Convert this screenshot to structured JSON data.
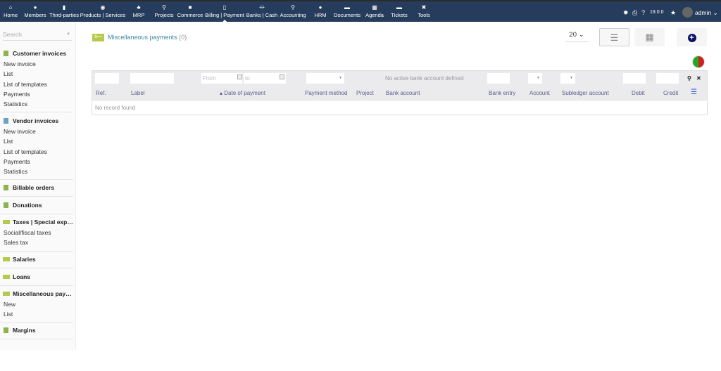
{
  "topmenu": [
    {
      "label": "Home",
      "icon": "home-icon",
      "glyph": "⌂"
    },
    {
      "label": "Members",
      "icon": "user-icon",
      "glyph": "●"
    },
    {
      "label": "Third-parties",
      "icon": "building-icon",
      "glyph": "▮"
    },
    {
      "label": "Products | Services",
      "icon": "cube-icon",
      "glyph": "◉"
    },
    {
      "label": "MRP",
      "icon": "cubes-icon",
      "glyph": "♣"
    },
    {
      "label": "Projects",
      "icon": "sitemap-icon",
      "glyph": "⚲"
    },
    {
      "label": "Commerce",
      "icon": "briefcase-icon",
      "glyph": "■"
    },
    {
      "label": "Billing | Payment",
      "icon": "file-invoice-icon",
      "glyph": "▯",
      "active": true
    },
    {
      "label": "Banks | Cash",
      "icon": "bank-icon",
      "glyph": "⏛"
    },
    {
      "label": "Accounting",
      "icon": "search-dollar-icon",
      "glyph": "⚲"
    },
    {
      "label": "HRM",
      "icon": "user-tie-icon",
      "glyph": "●"
    },
    {
      "label": "Documents",
      "icon": "folder-icon",
      "glyph": "▬"
    },
    {
      "label": "Agenda",
      "icon": "calendar-icon",
      "glyph": "▦"
    },
    {
      "label": "Tickets",
      "icon": "ticket-icon",
      "glyph": "▬"
    },
    {
      "label": "Tools",
      "icon": "tools-icon",
      "glyph": "✖"
    }
  ],
  "topright": {
    "version": "19.0.0",
    "user": "admin"
  },
  "sidebar": {
    "search_placeholder": "Search",
    "blocks": [
      {
        "title": "Customer invoices",
        "items": [
          "New invoice",
          "List",
          "List of templates",
          "Payments",
          "Statistics"
        ]
      },
      {
        "title": "Vendor invoices",
        "items": [
          "New invoice",
          "List",
          "List of templates",
          "Payments",
          "Statistics"
        ]
      },
      {
        "title": "Billable orders",
        "items": []
      },
      {
        "title": "Donations",
        "items": []
      },
      {
        "title": "Taxes | Special expenses",
        "items": [
          "Social/fiscal taxes",
          "Sales tax"
        ]
      },
      {
        "title": "Salaries",
        "items": []
      },
      {
        "title": "Loans",
        "items": []
      },
      {
        "title": "Miscellaneous payments",
        "items": [
          "New",
          "List"
        ]
      },
      {
        "title": "Margins",
        "items": []
      }
    ]
  },
  "page": {
    "title": "Miscellaneous payments",
    "count": "(0)",
    "limit": "20"
  },
  "filters": {
    "from": "From",
    "to": "to",
    "bank_account": "No active bank account defined"
  },
  "columns": [
    "Ref.",
    "Label",
    "Date of payment",
    "Payment method",
    "Project",
    "Bank account",
    "Bank entry",
    "Account",
    "Subledger account",
    "Debit",
    "Credit"
  ],
  "empty": "No record found",
  "colors": {
    "topbar": "#263c5c",
    "header_text": "#5a5e88",
    "title": "#3a8ba3"
  }
}
